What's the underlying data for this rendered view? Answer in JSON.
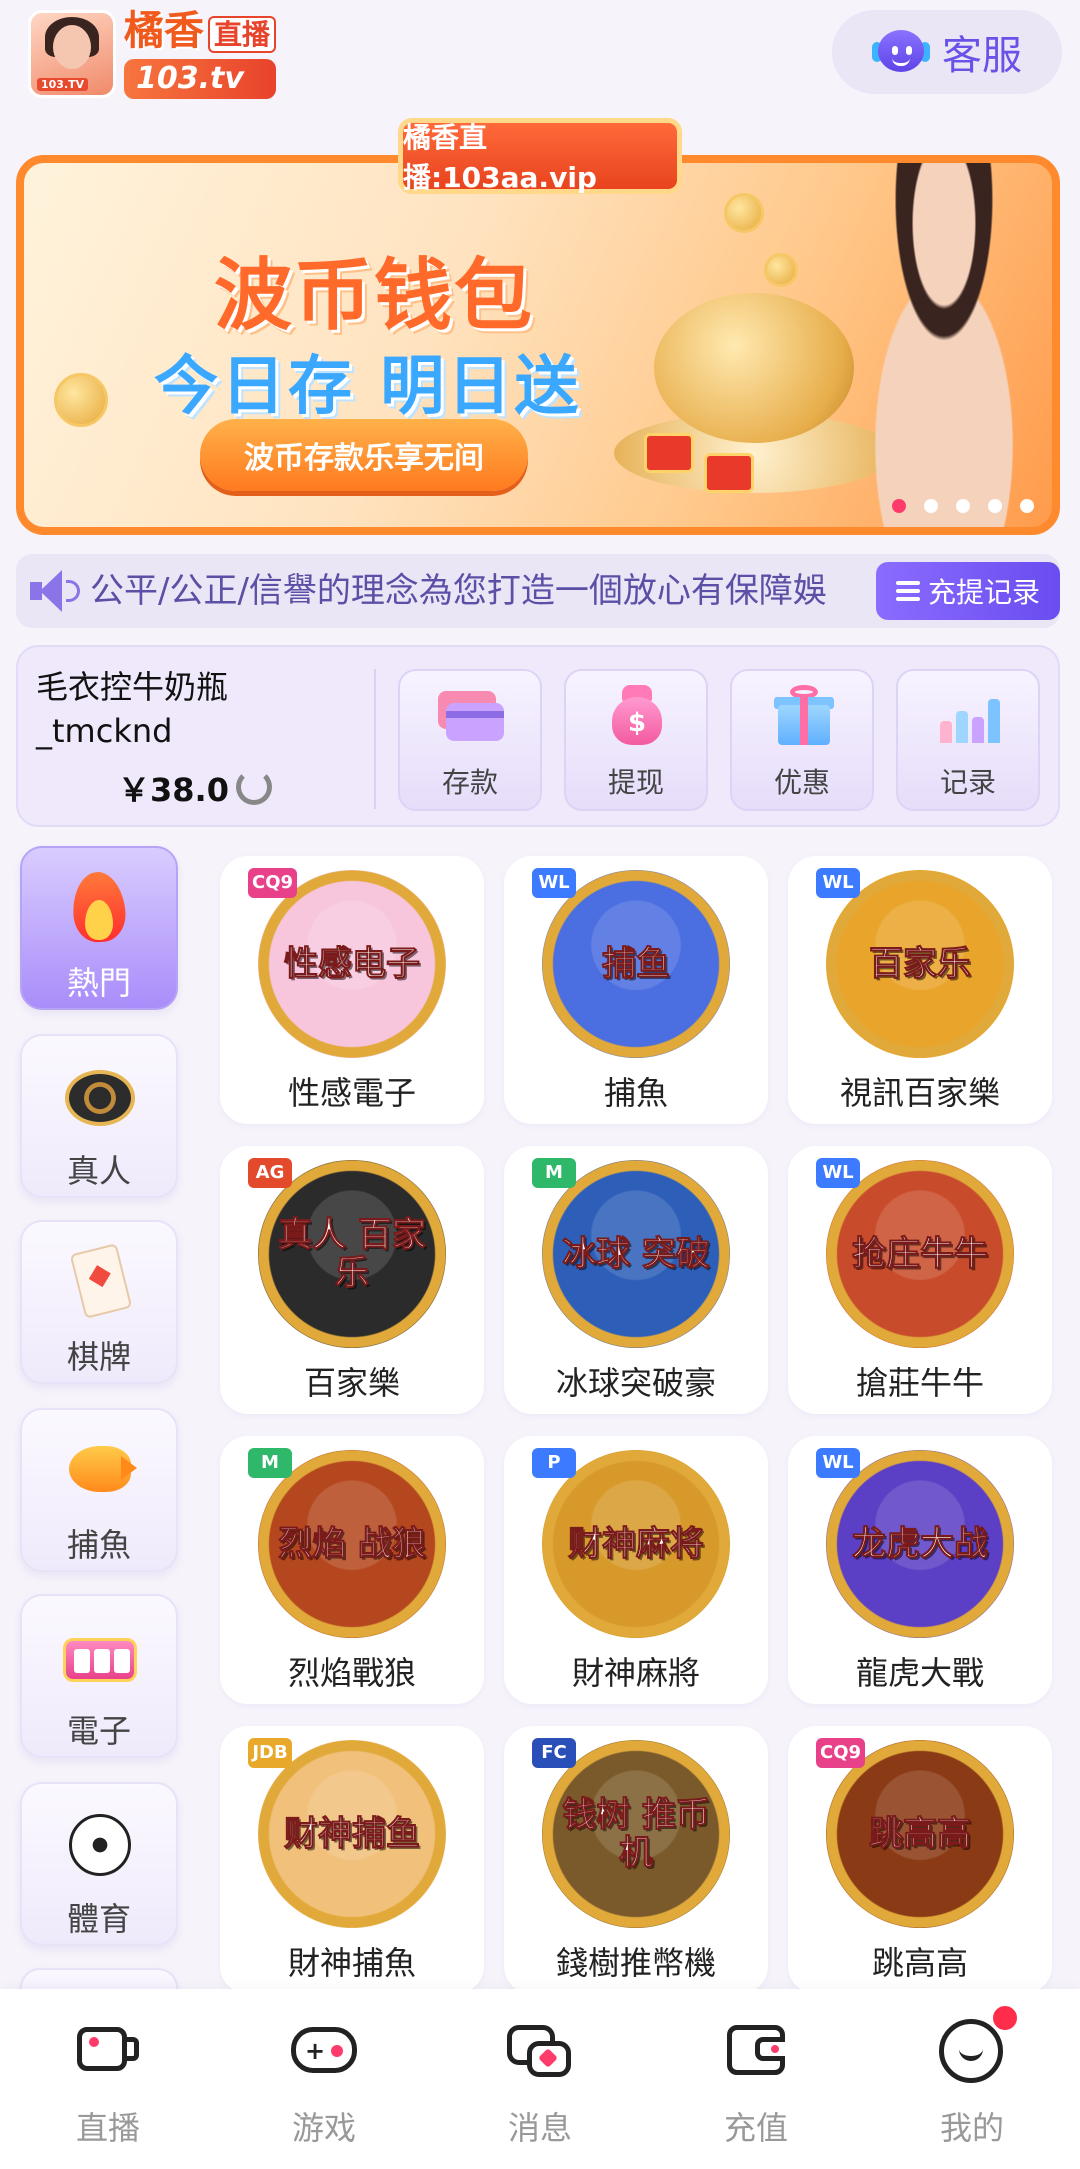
{
  "app": {
    "logo_brand": "橘香",
    "logo_live": "直播",
    "logo_site": "103.tv",
    "logo_thumb_tag": "103.TV"
  },
  "header": {
    "service_label": "客服"
  },
  "banner": {
    "badge": "橘香直播:103aa.vip",
    "title": "波币钱包",
    "subtitle": "今日存 明日送",
    "cta": "波币存款乐享无间",
    "dots_total": 5,
    "active_dot": 0
  },
  "marquee": {
    "text": "公平/公正/信譽的理念為您打造一個放心有保障娛",
    "recharge_button": "充提记录"
  },
  "account": {
    "username": "毛衣控牛奶瓶_tmckndl",
    "username_line1": "毛衣控牛奶瓶",
    "username_line2": "_tmcknd",
    "balance": "￥38.0",
    "actions": [
      {
        "label": "存款",
        "icon": "credit-card-icon"
      },
      {
        "label": "提现",
        "icon": "money-bag-icon"
      },
      {
        "label": "优惠",
        "icon": "gift-icon"
      },
      {
        "label": "记录",
        "icon": "bar-chart-icon"
      }
    ]
  },
  "categories": [
    {
      "label": "熱門",
      "icon": "flame-icon",
      "active": true
    },
    {
      "label": "真人",
      "icon": "casino-chip-icon",
      "active": false
    },
    {
      "label": "棋牌",
      "icon": "playing-card-icon",
      "active": false
    },
    {
      "label": "捕魚",
      "icon": "fish-icon",
      "active": false
    },
    {
      "label": "電子",
      "icon": "slot-machine-icon",
      "active": false
    },
    {
      "label": "體育",
      "icon": "soccer-ball-icon",
      "active": false
    }
  ],
  "games": [
    {
      "name": "性感電子",
      "art": "性感电子",
      "badge": "CQ9",
      "badge_color": "#e8418a",
      "bg": "#f7c6dd"
    },
    {
      "name": "捕魚",
      "art": "捕鱼",
      "badge": "WL",
      "badge_color": "#3c7bff",
      "bg": "#4b6ee0"
    },
    {
      "name": "視訊百家樂",
      "art": "百家乐",
      "badge": "WL",
      "badge_color": "#3c7bff",
      "bg": "#e9a42b"
    },
    {
      "name": "百家樂",
      "art": "真人 百家乐",
      "badge": "AG",
      "badge_color": "#e24a2b",
      "bg": "#2b2b2b"
    },
    {
      "name": "冰球突破豪",
      "art": "冰球 突破",
      "badge": "M",
      "badge_color": "#2fb86a",
      "bg": "#2d5fb8"
    },
    {
      "name": "搶莊牛牛",
      "art": "抢庄牛牛",
      "badge": "WL",
      "badge_color": "#3c7bff",
      "bg": "#c84c2b"
    },
    {
      "name": "烈焰戰狼",
      "art": "烈焰 战狼",
      "badge": "M",
      "badge_color": "#2fb86a",
      "bg": "#b4471e"
    },
    {
      "name": "財神麻將",
      "art": "财神麻将",
      "badge": "P",
      "badge_color": "#3c7bff",
      "bg": "#d79a2a"
    },
    {
      "name": "龍虎大戰",
      "art": "龙虎大战",
      "badge": "WL",
      "badge_color": "#3c7bff",
      "bg": "#5b3fc4"
    },
    {
      "name": "財神捕魚",
      "art": "财神捕鱼",
      "badge": "JDB",
      "badge_color": "#e8a92b",
      "bg": "#f1c07a"
    },
    {
      "name": "錢樹推幣機",
      "art": "钱树 推币机",
      "badge": "FC",
      "badge_color": "#2b4fb8",
      "bg": "#7a5a2a"
    },
    {
      "name": "跳高高",
      "art": "跳高高",
      "badge": "CQ9",
      "badge_color": "#e8418a",
      "bg": "#8a3a14"
    }
  ],
  "tabbar": [
    {
      "label": "直播",
      "icon": "video-camera-icon"
    },
    {
      "label": "游戏",
      "icon": "gamepad-icon"
    },
    {
      "label": "消息",
      "icon": "chat-bubbles-icon"
    },
    {
      "label": "充值",
      "icon": "wallet-icon"
    },
    {
      "label": "我的",
      "icon": "smiley-profile-icon"
    }
  ],
  "colors": {
    "accent": "#7a5cf0",
    "banner_orange": "#ff8a2d",
    "notification": "#ff2d4a"
  }
}
